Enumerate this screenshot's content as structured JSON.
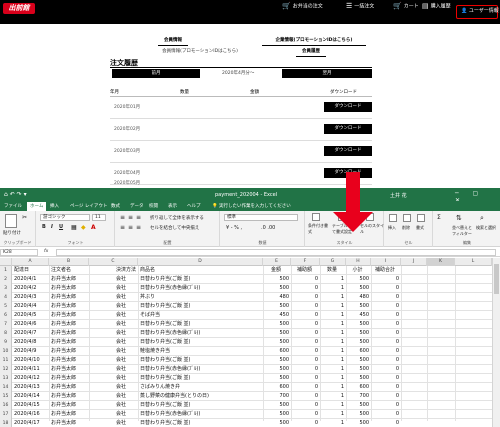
{
  "web": {
    "logo": "出前館",
    "nav": [
      {
        "label": "お弁当の注文",
        "icon": "cart-icon"
      },
      {
        "label": "一括注文",
        "icon": "list-icon"
      },
      {
        "label": "カート",
        "icon": "cart-icon"
      },
      {
        "label": "購入履歴",
        "icon": "history-icon"
      }
    ],
    "user_button": "ユーザー情報",
    "tabs_row1": [
      "会員情報",
      "企業情報(プロモーションIDはこちら)"
    ],
    "tabs_row2": [
      "会員情報(プロモーションIDはこちら)",
      "会員履歴"
    ],
    "order_history": {
      "title": "注文履歴",
      "filter_left_btn": "前月",
      "filter_center": "2020年4月分〜",
      "filter_right_btn": "翌月",
      "columns": [
        "年月",
        "数量",
        "金額",
        "ダウンロード"
      ],
      "download_label": "ダウンロード",
      "rows": [
        "2020年01月",
        "2020年02月",
        "2020年03月",
        "2020年04月",
        "2020年05月"
      ]
    }
  },
  "excel": {
    "qat": "⌂ ↶ ↷ ▾",
    "filename": "payment_202004 - Excel",
    "user": "土井 花",
    "window_controls": "─ ▢ ✕",
    "menu": [
      "ファイル",
      "ホーム",
      "挿入",
      "ページ レイアウト",
      "数式",
      "データ",
      "校閲",
      "表示",
      "ヘルプ",
      "実行したい作業を入力してください"
    ],
    "ribbon": {
      "clipboard": "クリップボード",
      "paste": "貼り付け",
      "font_name": "游ゴシック",
      "font_size": "11",
      "font": "フォント",
      "bold": "B",
      "italic": "I",
      "underline": "U",
      "wrap": "折り返して全体を表示する",
      "merge": "セルを結合して中央揃え",
      "alignment": "配置",
      "number_format": "標準",
      "number": "数値",
      "cond_format": "条件付き書式",
      "table_format": "テーブルとして書式設定",
      "cell_styles": "セルのスタイル",
      "styles": "スタイル",
      "insert": "挿入",
      "delete": "削除",
      "format": "書式",
      "cells": "セル",
      "sort": "並べ替えとフィルター",
      "find": "検索と選択",
      "editing": "編集"
    },
    "name_box": "K28",
    "fx": "fx",
    "columns": [
      "A",
      "B",
      "C",
      "D",
      "E",
      "F",
      "G",
      "H",
      "I",
      "J",
      "K",
      "L"
    ],
    "header_row": [
      "配達日",
      "注文者名",
      "決済方法",
      "商品名",
      "金額",
      "補助額",
      "数量",
      "小計",
      "補助合計"
    ],
    "rows": [
      [
        "2020/4/1",
        "お弁当太郎",
        "会社",
        "日替わり弁当(ご飯 並)",
        "500",
        "0",
        "1",
        "500",
        "0"
      ],
      [
        "2020/4/2",
        "お弁当太郎",
        "会社",
        "日替わり弁当(赤色縁(ﾌﾞﾙ))",
        "500",
        "0",
        "1",
        "500",
        "0"
      ],
      [
        "2020/4/3",
        "お弁当太郎",
        "会社",
        "丼ぶり",
        "480",
        "0",
        "1",
        "480",
        "0"
      ],
      [
        "2020/4/4",
        "お弁当太郎",
        "会社",
        "日替わり弁当(ご飯 並)",
        "500",
        "0",
        "1",
        "500",
        "0"
      ],
      [
        "2020/4/5",
        "お弁当太郎",
        "会社",
        "そば弁当",
        "450",
        "0",
        "1",
        "450",
        "0"
      ],
      [
        "2020/4/6",
        "お弁当太郎",
        "会社",
        "日替わり弁当(ご飯 並)",
        "500",
        "0",
        "1",
        "500",
        "0"
      ],
      [
        "2020/4/7",
        "お弁当太郎",
        "会社",
        "日替わり弁当(赤色縁(ﾌﾞﾙ))",
        "500",
        "0",
        "1",
        "500",
        "0"
      ],
      [
        "2020/4/8",
        "お弁当太郎",
        "会社",
        "日替わり弁当(ご飯 並)",
        "500",
        "0",
        "1",
        "500",
        "0"
      ],
      [
        "2020/4/9",
        "お弁当太郎",
        "会社",
        "鮭塩焼き弁当",
        "600",
        "0",
        "1",
        "600",
        "0"
      ],
      [
        "2020/4/10",
        "お弁当太郎",
        "会社",
        "日替わり弁当(ご飯 並)",
        "500",
        "0",
        "1",
        "500",
        "0"
      ],
      [
        "2020/4/11",
        "お弁当太郎",
        "会社",
        "日替わり弁当(赤色縁(ﾌﾞﾙ))",
        "500",
        "0",
        "1",
        "500",
        "0"
      ],
      [
        "2020/4/12",
        "お弁当太郎",
        "会社",
        "日替わり弁当(ご飯 並)",
        "500",
        "0",
        "1",
        "500",
        "0"
      ],
      [
        "2020/4/13",
        "お弁当太郎",
        "会社",
        "さばみりん焼き弁",
        "600",
        "0",
        "1",
        "600",
        "0"
      ],
      [
        "2020/4/14",
        "お弁当太郎",
        "会社",
        "蒸し野菜の健康弁当(とりの日)",
        "700",
        "0",
        "1",
        "700",
        "0"
      ],
      [
        "2020/4/15",
        "お弁当太郎",
        "会社",
        "日替わり弁当(ご飯 並)",
        "500",
        "0",
        "1",
        "500",
        "0"
      ],
      [
        "2020/4/16",
        "お弁当太郎",
        "会社",
        "日替わり弁当(赤色縁(ﾌﾞﾙ))",
        "500",
        "0",
        "1",
        "500",
        "0"
      ],
      [
        "2020/4/17",
        "お弁当太郎",
        "会社",
        "日替わり弁当(ご飯 並)",
        "500",
        "0",
        "1",
        "500",
        "0"
      ]
    ],
    "colors": {
      "excel_green": "#217346",
      "arrow_red": "#e8001c"
    }
  }
}
